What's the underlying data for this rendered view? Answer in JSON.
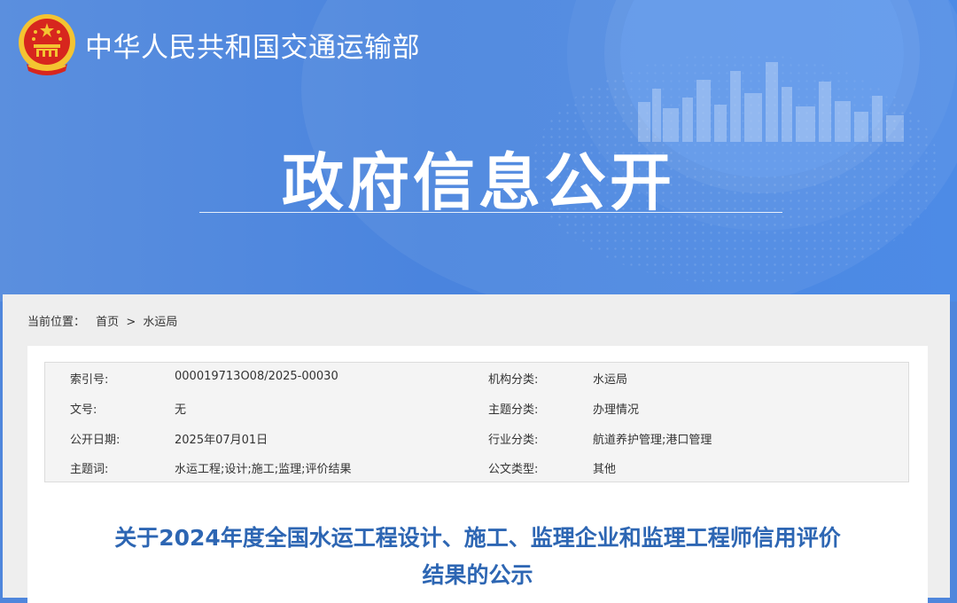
{
  "header": {
    "org_name": "中华人民共和国交通运输部",
    "page_title": "政府信息公开"
  },
  "breadcrumb": {
    "prefix": "当前位置：",
    "items": [
      "首页",
      "水运局"
    ],
    "separator": ">"
  },
  "metadata": {
    "rows": [
      {
        "label1": "索引号:",
        "value1": "000019713O08/2025-00030",
        "label2": "机构分类:",
        "value2": "水运局"
      },
      {
        "label1": "文号:",
        "value1": "无",
        "label2": "主题分类:",
        "value2": "办理情况"
      },
      {
        "label1": "公开日期:",
        "value1": "2025年07月01日",
        "label2": "行业分类:",
        "value2": "航道养护管理;港口管理"
      },
      {
        "label1": "主题词:",
        "value1": "水运工程;设计;施工;监理;评价结果",
        "label2": "公文类型:",
        "value2": "其他"
      }
    ]
  },
  "article": {
    "title_line1": "关于2024年度全国水运工程设计、施工、监理企业和监理工程师信用评价",
    "title_line2": "结果的公示"
  },
  "colors": {
    "banner": "#4a84de",
    "title_blue": "#2d66b3",
    "emblem_red": "#d7261e",
    "emblem_gold": "#f4c431"
  }
}
